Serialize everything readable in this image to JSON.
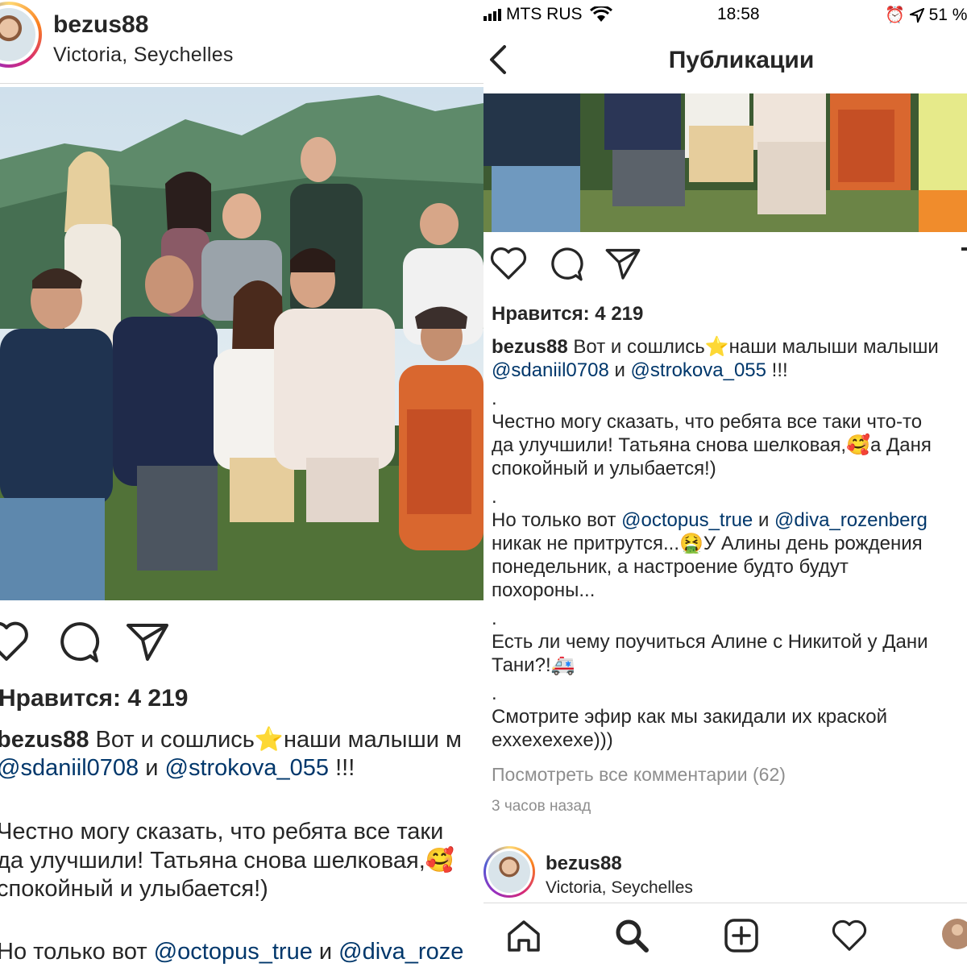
{
  "left_panel": {
    "header": {
      "username": "bezus88",
      "location": "Victoria, Seychelles"
    },
    "likes": "Нравится: 4 219",
    "caption_lines": [
      {
        "user": "bezus88",
        "text": " Вот и сошлись",
        "emoji": "⭐",
        "rest": "наши малыши м"
      },
      {
        "mention1": "@sdaniil0708",
        "mid": " и ",
        "mention2": "@strokova_055",
        "end": " !!!"
      },
      {
        "text": "Честно могу сказать, что ребята все таки"
      },
      {
        "text": "да улучшили! Татьяна снова шелковая,",
        "emoji": "🥰"
      },
      {
        "text": "спокойный и улыбается!)"
      },
      {
        "pre": "Но только вот ",
        "mention1": "@octopus_true",
        "mid": " и ",
        "mention2": "@diva_roze"
      }
    ]
  },
  "right_panel": {
    "status_bar": {
      "carrier": "MTS RUS",
      "time": "18:58",
      "battery": "51 %"
    },
    "nav_title": "Публикации",
    "likes": "Нравится: 4 219",
    "caption": {
      "line1_user": "bezus88",
      "line1_text": " Вот и сошлись",
      "line1_emoji": "⭐",
      "line1_rest": "наши малыши малыши",
      "line2_mention1": "@sdaniil0708",
      "line2_mid": " и ",
      "line2_mention2": "@strokova_055",
      "line2_end": " !!!",
      "dot": ".",
      "p2_l1": "Честно могу сказать, что ребята все таки что-то",
      "p2_l2a": "да улучшили! Татьяна снова шелковая,",
      "p2_l2_emoji": "🥰",
      "p2_l2b": "а Даня",
      "p2_l3": "спокойный и улыбается!)",
      "p3_pre": "Но только вот ",
      "p3_mention1": "@octopus_true",
      "p3_mid": " и ",
      "p3_mention2": "@diva_rozenberg",
      "p3_l2a": "никак не притрутся...",
      "p3_l2_emoji": "🤮",
      "p3_l2b": "У Алины день рождения",
      "p3_l3": "понедельник, а настроение будто будут",
      "p3_l4": "похороны...",
      "p4_l1": "Есть ли чему поучиться Алине с Никитой у Дани",
      "p4_l2": "Тани?!",
      "p4_emoji": "🚑",
      "p5_l1": "Смотрите эфир как мы закидали их краской",
      "p5_l2": "exxexexexe)))"
    },
    "view_comments": "Посмотреть все комментарии (62)",
    "time_ago": "3 часов назад",
    "next_post": {
      "username": "bezus88",
      "location": "Victoria, Seychelles"
    },
    "tabs": [
      "home-icon",
      "search-icon",
      "add-icon",
      "heart-icon",
      "profile-avatar"
    ]
  },
  "colors": {
    "text": "#262626",
    "mention": "#00376b",
    "muted": "#8e8e8e",
    "divider": "#dbdbdb"
  }
}
